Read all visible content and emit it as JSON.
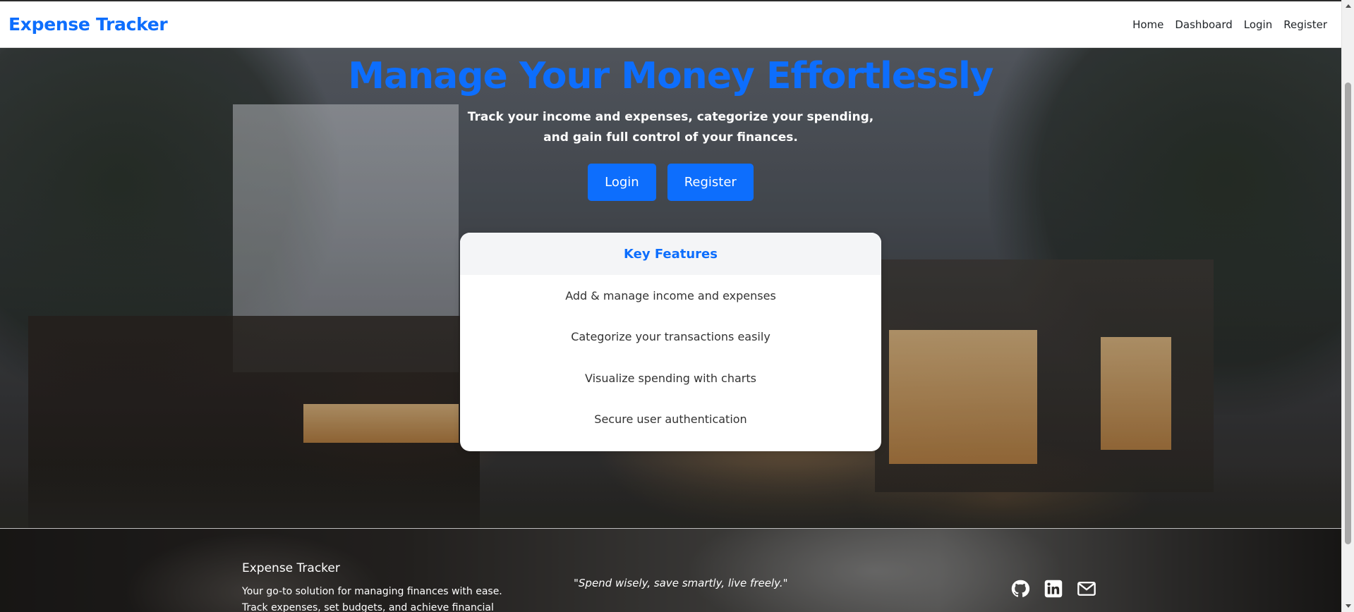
{
  "navbar": {
    "brand": "Expense Tracker",
    "links": [
      {
        "label": "Home"
      },
      {
        "label": "Dashboard"
      },
      {
        "label": "Login"
      },
      {
        "label": "Register"
      }
    ]
  },
  "hero": {
    "title": "Manage Your Money Effortlessly",
    "subtitle": "Track your income and expenses, categorize your spending, and gain full control of your finances.",
    "login_button": "Login",
    "register_button": "Register"
  },
  "features": {
    "heading": "Key Features",
    "items": [
      "Add & manage income and expenses",
      "Categorize your transactions easily",
      "Visualize spending with charts",
      "Secure user authentication"
    ]
  },
  "footer": {
    "brand": "Expense Tracker",
    "description": "Your go-to solution for managing finances with ease. Track expenses, set budgets, and achieve financial freedom.",
    "quote": "\"Spend wisely, save smartly, live freely.\"",
    "icons": [
      "github-icon",
      "linkedin-icon",
      "mail-icon"
    ]
  },
  "colors": {
    "accent": "#0d6efd",
    "text_dark": "#212529",
    "white": "#ffffff"
  }
}
